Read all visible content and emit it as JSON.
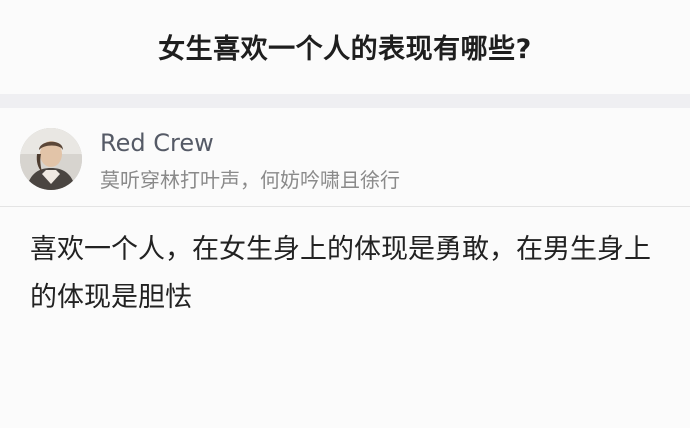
{
  "question": {
    "title": "女生喜欢一个人的表现有哪些?"
  },
  "author": {
    "name": "Red Crew",
    "bio": "莫听穿林打叶声，何妨吟啸且徐行",
    "avatar_icon": "user-avatar-icon"
  },
  "answer": {
    "text": "喜欢一个人，在女生身上的体现是勇敢，在男生身上的体现是胆怯"
  },
  "colors": {
    "background": "#fbfbfb",
    "band": "#efeff2",
    "author_name": "#555a66",
    "bio": "#8a8a8a",
    "text": "#222222"
  }
}
